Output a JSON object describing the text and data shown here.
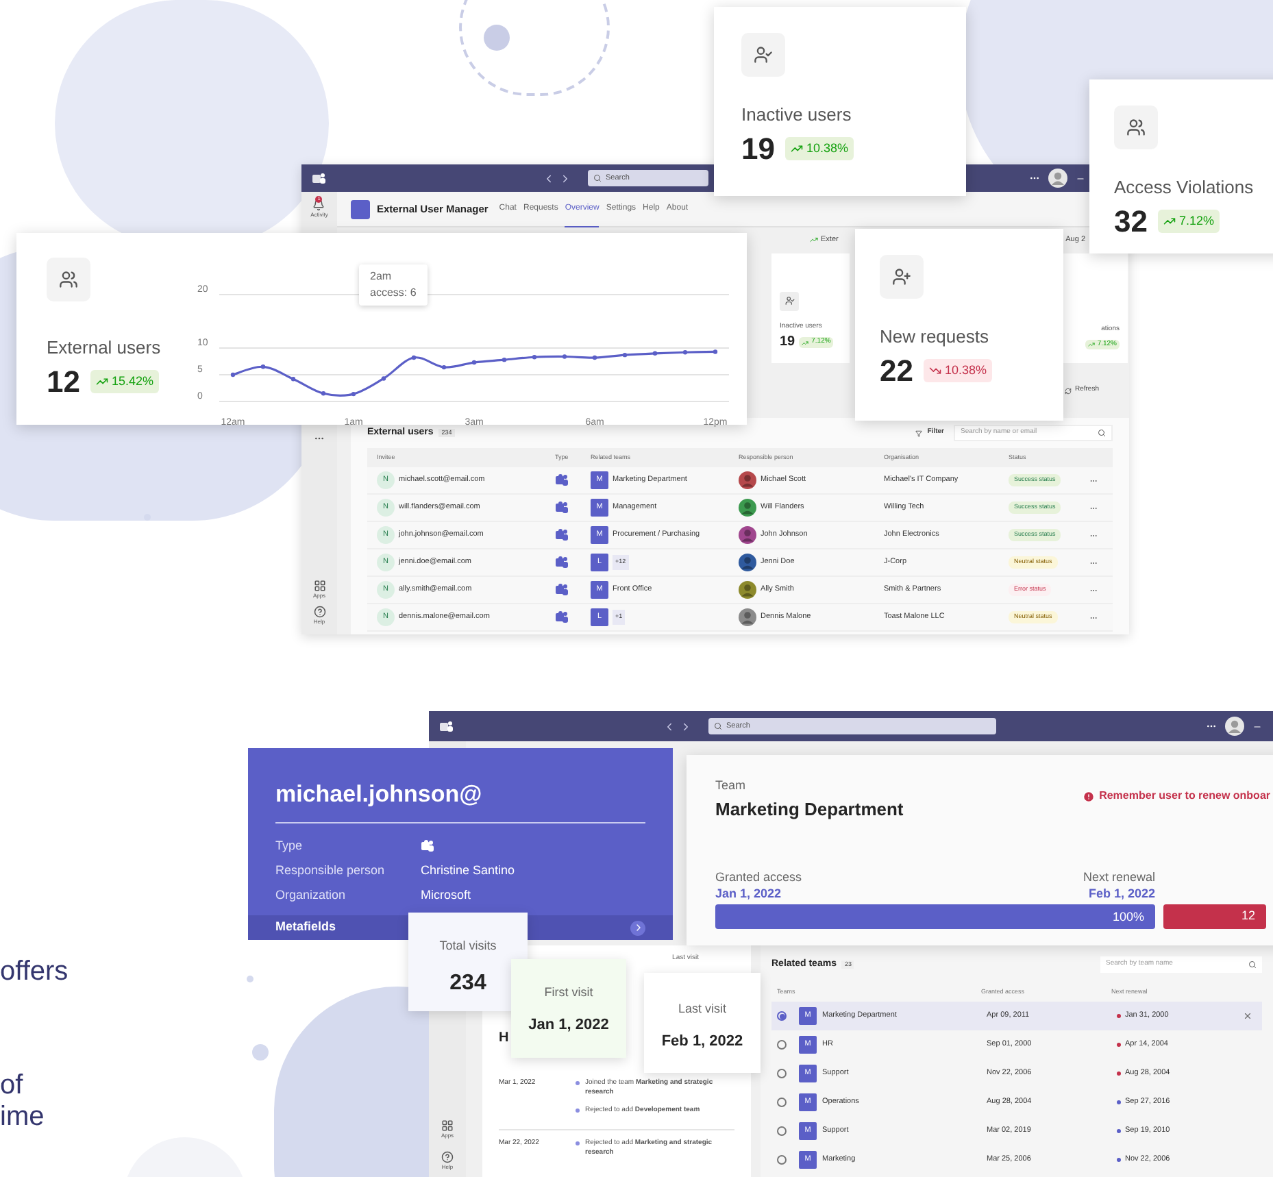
{
  "side_text": [
    "offers",
    "of",
    "ime"
  ],
  "stat_cards": [
    {
      "label": "Inactive users",
      "value": "19",
      "change": "10.38%",
      "kind": "up"
    },
    {
      "label": "Access Violations",
      "value": "32",
      "change": "7.12%",
      "kind": "up"
    },
    {
      "label": "External users",
      "value": "12",
      "change": "15.42%",
      "kind": "up",
      "tooltip": {
        "title": "2am",
        "text": "access: 6"
      },
      "chart_data": {
        "type": "line",
        "categories": [
          "12am",
          null,
          null,
          null,
          "1am",
          null,
          null,
          null,
          "3am",
          null,
          null,
          null,
          "6am",
          null,
          null,
          null,
          "12pm"
        ],
        "series": [
          {
            "color": "#5b5fc7",
            "marker": "circle",
            "values": [
              5,
              6.5,
              4.2,
              1.5,
              1.4,
              4.3,
              8.2,
              6.4,
              7.3,
              7.8,
              8.3,
              8.4,
              8.2,
              8.7,
              9.0,
              9.2,
              9.3
            ]
          }
        ],
        "ylim": [
          0,
          20
        ],
        "yticks": [
          0,
          5,
          10,
          20
        ]
      }
    },
    {
      "label": "New requests",
      "value": "22",
      "change": "10.38%",
      "kind": "down"
    }
  ],
  "top_window": {
    "search_placeholder": "Search",
    "sidebar": [
      {
        "label": "Activity",
        "badge": "1"
      },
      {
        "label": "Apps"
      },
      {
        "label": "Help"
      }
    ],
    "app_title": "External User Manager",
    "tabs": [
      {
        "label": "Chat",
        "selected": false
      },
      {
        "label": "Requests",
        "selected": false
      },
      {
        "label": "Overview",
        "selected": true
      },
      {
        "label": "Settings",
        "selected": false
      },
      {
        "label": "Help",
        "selected": false
      },
      {
        "label": "About",
        "selected": false
      }
    ],
    "trend_label": "Exter",
    "date": "Aug 2",
    "mini_cards": [
      {
        "label": "Inactive users",
        "value": "19",
        "change": "7.12%"
      },
      {
        "label": "ations",
        "change": "7.12%"
      }
    ],
    "refresh": "Refresh",
    "table": {
      "title": "External users",
      "count": "234",
      "filter": "Filter",
      "search_placeholder": "Search by name or email",
      "columns": [
        "Invitee",
        "Type",
        "Related teams",
        "Responsible person",
        "Organisation",
        "Status"
      ],
      "rows": [
        {
          "initial": "N",
          "invitee": "michael.scott@email.com",
          "team_initial": "M",
          "team": "Marketing Department",
          "person": "Michael Scott",
          "color": "#b5484b",
          "organisation": "Michael's IT Company",
          "status": "Success status",
          "kind": "success"
        },
        {
          "initial": "N",
          "invitee": "will.flanders@email.com",
          "team_initial": "M",
          "team": "Management",
          "person": "Will Flanders",
          "color": "#3c9a4f",
          "organisation": "Willing Tech",
          "status": "Success status",
          "kind": "success"
        },
        {
          "initial": "N",
          "invitee": "john.johnson@email.com",
          "team_initial": "M",
          "team": "Procurement / Purchasing",
          "person": "John Johnson",
          "color": "#a0468e",
          "organisation": "John Electronics",
          "status": "Success status",
          "kind": "success"
        },
        {
          "initial": "N",
          "invitee": "jenni.doe@email.com",
          "team_initial": "L",
          "team_extra": "+12",
          "person": "Jenni Doe",
          "color": "#2f5a9e",
          "organisation": "J-Corp",
          "status": "Neutral status",
          "kind": "neutral"
        },
        {
          "initial": "N",
          "invitee": "ally.smith@email.com",
          "team_initial": "M",
          "team": "Front Office",
          "person": "Ally Smith",
          "color": "#8d8a2c",
          "organisation": "Smith & Partners",
          "status": "Error status",
          "kind": "error"
        },
        {
          "initial": "N",
          "invitee": "dennis.malone@email.com",
          "team_initial": "L",
          "team_extra": "+1",
          "person": "Dennis Malone",
          "color": "#8a8a8a",
          "organisation": "Toast Malone LLC",
          "status": "Neutral status",
          "kind": "neutral"
        }
      ]
    }
  },
  "bottom_window": {
    "search_placeholder": "Search",
    "sidebar": [
      {
        "label": "Apps"
      },
      {
        "label": "Help"
      }
    ],
    "history": {
      "last_visit_header": "Last visit",
      "heading": "H",
      "entries": [
        {
          "date": "Mar 1, 2022",
          "events": [
            "Joined the team **Marketing and strategic research**",
            "Rejected to add **Developement team**"
          ]
        },
        {
          "date": "Mar 22, 2022",
          "events": [
            "Rejected to add **Marketing and strategic research**"
          ]
        }
      ]
    },
    "related_teams": {
      "title": "Related teams",
      "count": "23",
      "search_placeholder": "Search by team name",
      "columns": [
        "Teams",
        "Granted access",
        "Next renewal"
      ],
      "rows": [
        {
          "selected": true,
          "initial": "M",
          "name": "Marketing Department",
          "granted": "Apr 09, 2011",
          "renewal": "Jan 31, 2000",
          "color": "#c4314b"
        },
        {
          "selected": false,
          "initial": "M",
          "name": "HR",
          "granted": "Sep 01, 2000",
          "renewal": "Apr 14, 2004",
          "color": "#c4314b"
        },
        {
          "selected": false,
          "initial": "M",
          "name": "Support",
          "granted": "Nov 22, 2006",
          "renewal": "Aug 28, 2004",
          "color": "#c4314b"
        },
        {
          "selected": false,
          "initial": "M",
          "name": "Operations",
          "granted": "Aug 28, 2004",
          "renewal": "Sep 27, 2016",
          "color": "#5b5fc7"
        },
        {
          "selected": false,
          "initial": "M",
          "name": "Support",
          "granted": "Mar 02, 2019",
          "renewal": "Sep 19, 2010",
          "color": "#5b5fc7"
        },
        {
          "selected": false,
          "initial": "M",
          "name": "Marketing",
          "granted": "Mar 25, 2006",
          "renewal": "Nov 22, 2006",
          "color": "#5b5fc7"
        }
      ]
    }
  },
  "profile": {
    "title": "michael.johnson@",
    "fields": [
      {
        "label": "Type",
        "kind": "icon"
      },
      {
        "label": "Responsible person",
        "kind": "text",
        "value": "Christine Santino"
      },
      {
        "label": "Organization",
        "kind": "text",
        "value": "Microsoft"
      }
    ],
    "footer": "Metafields"
  },
  "team": {
    "caption": "Team",
    "name": "Marketing Department",
    "alert": "Remember user to renew onboar",
    "granted_label": "Granted access",
    "granted": "Jan 1, 2022",
    "renewal_label": "Next renewal",
    "renewal": "Feb 1, 2022",
    "progress": {
      "level": 1,
      "reading": "100%"
    },
    "overdue": "12"
  },
  "visits": [
    {
      "label": "Total visits",
      "value": "234"
    },
    {
      "label": "First visit",
      "value": "Jan 1, 2022"
    },
    {
      "label": "Last visit",
      "value": "Feb 1, 2022"
    }
  ]
}
